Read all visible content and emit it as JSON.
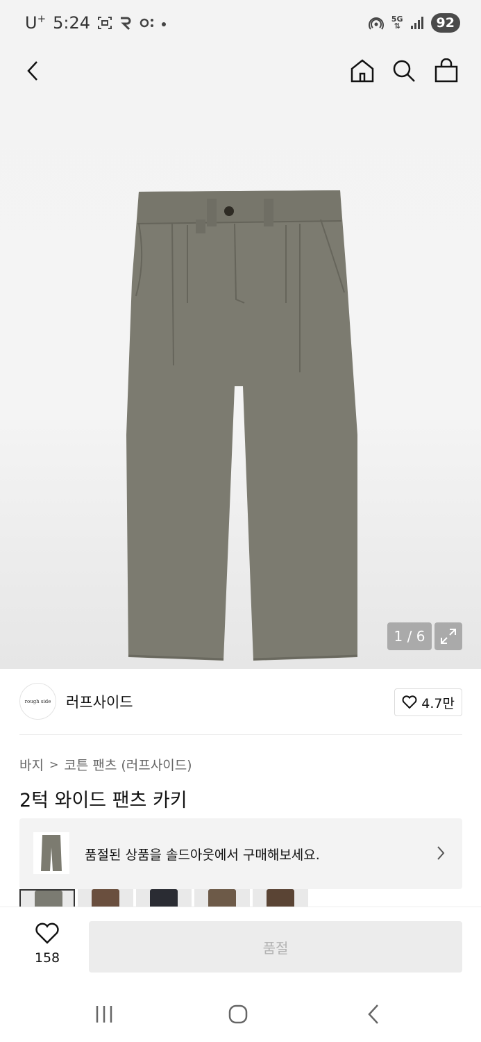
{
  "status_bar": {
    "carrier": "U",
    "carrier_sup": "+",
    "time": "5:24",
    "battery": "92",
    "network": "5G"
  },
  "top_nav": {
    "icons": [
      "back-icon",
      "home-icon",
      "search-icon",
      "shopping-bag-icon"
    ]
  },
  "gallery": {
    "counter": "1 / 6"
  },
  "brand": {
    "logo_text": "rough side",
    "name": "러프사이드",
    "likes": "4.7만"
  },
  "breadcrumb": {
    "items": [
      "바지",
      "코튼 팬츠 (러프사이드)"
    ]
  },
  "product": {
    "title": "2턱 와이드 팬츠 카키"
  },
  "soldout_banner": {
    "text": "품절된 상품을 솔드아웃에서 구매해보세요."
  },
  "swatch_colors": [
    "#7b7b72",
    "#6a4f3e",
    "#2a2c33",
    "#6d5a48",
    "#5a4434"
  ],
  "action_bar": {
    "wish_count": "158",
    "buy_label": "품절"
  },
  "colors": {
    "pants": "#7c7b70",
    "button_disabled_bg": "#ececec",
    "button_disabled_text": "#b3b3b3"
  }
}
